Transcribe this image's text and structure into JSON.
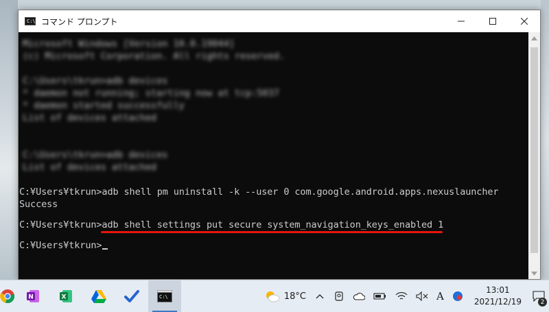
{
  "window": {
    "title": "コマンド プロンプト",
    "title_icon_text": "C:\\."
  },
  "console": {
    "blurred_lines": [
      "Microsoft Windows [Version 10.0.19044]",
      "(c) Microsoft Corporation. All rights reserved.",
      "",
      "C:\\Users\\tkrun>adb devices",
      "* daemon not running; starting now at tcp:5037",
      "* daemon started successfully",
      "List of devices attached",
      "",
      "",
      "C:\\Users\\tkrun>adb devices",
      "List of devices attached"
    ],
    "line1": "C:¥Users¥tkrun>adb shell pm uninstall -k --user 0 com.google.android.apps.nexuslauncher",
    "line2": "Success",
    "line3_prompt": "C:¥Users¥tkrun>",
    "line3_command": "adb shell settings put secure system_navigation_keys_enabled 1",
    "line4_prompt": "C:¥Users¥tkrun>",
    "highlight_color": "#e8150d"
  },
  "taskbar": {
    "apps": [
      {
        "name": "chrome-icon"
      },
      {
        "name": "onenote-icon"
      },
      {
        "name": "excel-icon"
      },
      {
        "name": "google-drive-icon"
      },
      {
        "name": "todo-icon"
      },
      {
        "name": "command-prompt-icon",
        "active": true
      }
    ],
    "weather_temp": "18°C",
    "ime_indicator": "A",
    "time": "13:01",
    "date": "2021/12/19",
    "notification_count": "2"
  }
}
